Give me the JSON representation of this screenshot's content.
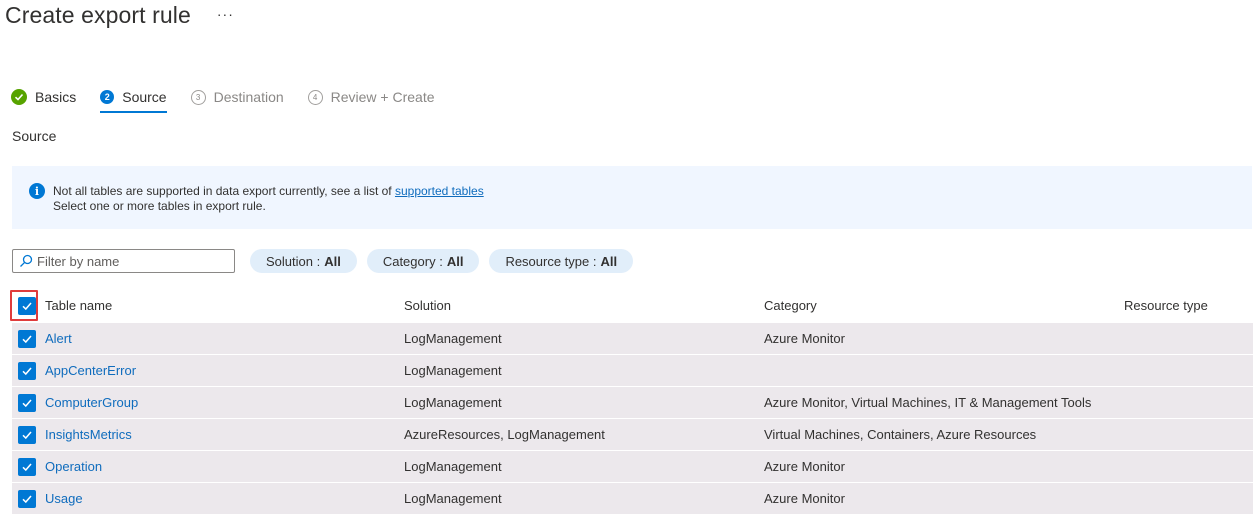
{
  "page": {
    "title": "Create export rule",
    "more_label": "···"
  },
  "wizard": {
    "steps": [
      {
        "number": "",
        "label": "Basics",
        "state": "done"
      },
      {
        "number": "2",
        "label": "Source",
        "state": "active"
      },
      {
        "number": "3",
        "label": "Destination",
        "state": "pending"
      },
      {
        "number": "4",
        "label": "Review + Create",
        "state": "pending"
      }
    ]
  },
  "section": {
    "label": "Source"
  },
  "info": {
    "line1_prefix": "Not all tables are supported in data export currently, see a list of ",
    "link_text": "supported tables",
    "line2": "Select one or more tables in export rule."
  },
  "filters": {
    "search_placeholder": "Filter by name",
    "search_value": "",
    "pills": [
      {
        "label": "Solution :",
        "value": "All"
      },
      {
        "label": "Category :",
        "value": "All"
      },
      {
        "label": "Resource type :",
        "value": "All"
      }
    ]
  },
  "table": {
    "columns": [
      "Table name",
      "Solution",
      "Category",
      "Resource type"
    ],
    "header_checked": true,
    "rows": [
      {
        "name": "Alert",
        "solution": "LogManagement",
        "category": "Azure Monitor",
        "resource_type": "",
        "checked": true
      },
      {
        "name": "AppCenterError",
        "solution": "LogManagement",
        "category": "",
        "resource_type": "",
        "checked": true
      },
      {
        "name": "ComputerGroup",
        "solution": "LogManagement",
        "category": "Azure Monitor, Virtual Machines, IT & Management Tools",
        "resource_type": "",
        "checked": true
      },
      {
        "name": "InsightsMetrics",
        "solution": "AzureResources, LogManagement",
        "category": "Virtual Machines, Containers, Azure Resources",
        "resource_type": "",
        "checked": true
      },
      {
        "name": "Operation",
        "solution": "LogManagement",
        "category": "Azure Monitor",
        "resource_type": "",
        "checked": true
      },
      {
        "name": "Usage",
        "solution": "LogManagement",
        "category": "Azure Monitor",
        "resource_type": "",
        "checked": true
      }
    ]
  },
  "colors": {
    "accent": "#0078d4",
    "success": "#57a300",
    "link": "#0f6cbd",
    "highlight": "#e03c3c"
  }
}
